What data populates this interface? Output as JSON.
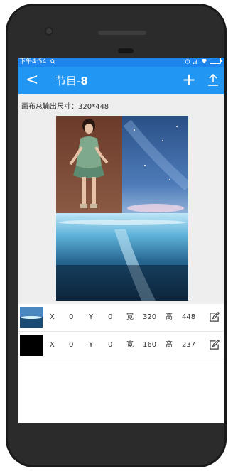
{
  "status": {
    "time": "下午4:54",
    "search_glyph": "🔍"
  },
  "header": {
    "back_symbol": "<",
    "title_prefix": "节目-",
    "title_number": "8",
    "add_symbol": "+"
  },
  "canvas": {
    "caption": "画布总输出尺寸：320*448"
  },
  "layers": [
    {
      "x_label": "X",
      "x": "0",
      "y_label": "Y",
      "y": "0",
      "w_label": "宽",
      "w": "320",
      "h_label": "高",
      "h": "448"
    },
    {
      "x_label": "X",
      "x": "0",
      "y_label": "Y",
      "y": "0",
      "w_label": "宽",
      "w": "160",
      "h_label": "高",
      "h": "237"
    }
  ],
  "colors": {
    "statusbar": "#1c86ee",
    "toolbar": "#2196f3",
    "canvas_bg": "#eeeeee"
  }
}
